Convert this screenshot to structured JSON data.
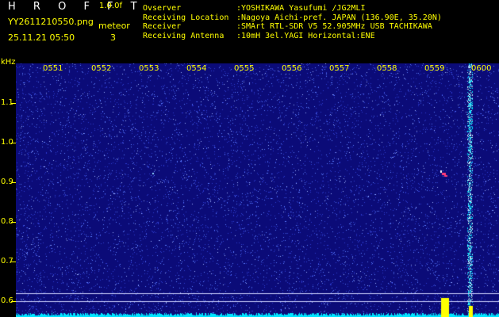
{
  "header": {
    "app_name": "H R O F F T",
    "version": "1.0.0f",
    "filename": "YY2611210550.png",
    "datetime": "25.11.21 05:50",
    "meteor_label": "meteor",
    "meteor_count": "3",
    "info": [
      {
        "key": "Ovserver",
        "value": ":YOSHIKAWA Yasufumi /JG2MLI"
      },
      {
        "key": "Receiving Location",
        "value": ":Nagoya Aichi-pref. JAPAN (136.90E, 35.20N)"
      },
      {
        "key": "Receiver",
        "value": ":SMArt RTL-SDR V5 52.905MHz USB TACHIKAWA"
      },
      {
        "key": "Receiving Antenna",
        "value": ":10mH 3el.YAGI Horizontal:ENE"
      }
    ]
  },
  "plot": {
    "y_unit": "kHz",
    "y_labels": [
      "1.1",
      "1.0",
      "0.9",
      "0.8",
      "0.7",
      "0.6"
    ],
    "time_labels": [
      "0551",
      "0552",
      "0553",
      "0554",
      "0555",
      "0556",
      "0557",
      "0558",
      "0559",
      "0600"
    ],
    "colors": {
      "background": "#0b0b78",
      "noise": "#5a7cff",
      "signal": "#00e5ff",
      "meteor_echo": "#ff3b7a",
      "label": "#ffff00"
    }
  }
}
